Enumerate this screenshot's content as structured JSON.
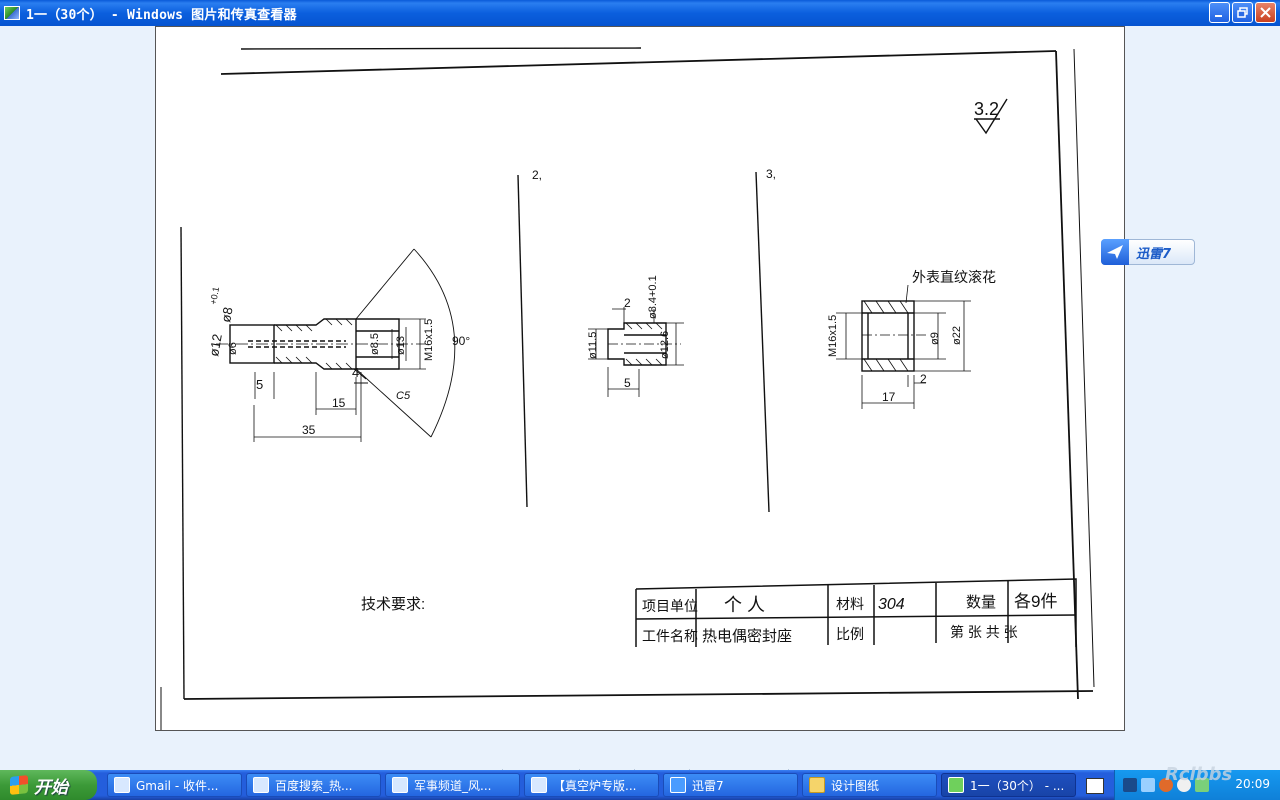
{
  "window": {
    "title": "1一（30个） - Windows 图片和传真查看器"
  },
  "drawing": {
    "surface_finish": "3.2",
    "view_numbers": [
      "2,",
      "3,"
    ],
    "part1_dims": {
      "d12": "ø12",
      "d6": "ø6",
      "d8": "ø8",
      "tol": "+0.1",
      "d8_5": "ø8.5",
      "d13": "ø13",
      "thread": "M16x1.5",
      "angle": "90°",
      "len5": "5",
      "len4": "4",
      "len15": "15",
      "len35": "35",
      "chamfer": "C5"
    },
    "part2_dims": {
      "d8_4": "ø8.4+0.1",
      "len2": "2",
      "d11_5": "ø11.5",
      "d12_6": "ø12.6",
      "len5": "5"
    },
    "part3_dims": {
      "note": "外表直纹滚花",
      "thread": "M16x1.5",
      "d9": "ø9",
      "d22": "ø22",
      "len2": "2",
      "len17": "17"
    },
    "tech_req": "技术要求:",
    "titleblock": {
      "project_unit_label": "项目单位",
      "project_unit_value": "个 人",
      "material_label": "材料",
      "material_value": "304",
      "qty_label": "数量",
      "qty_value": "各9件",
      "part_name_label": "工件名称",
      "part_name_value": "热电偶密封座",
      "scale_label": "比例",
      "sheet_text": "第  张  共  张"
    }
  },
  "overlay": {
    "xunlei_label": "迅雷7"
  },
  "toolbar": {
    "buttons": [
      "prev-image",
      "next-image",
      "best-fit",
      "actual-size",
      "slideshow",
      "zoom-in",
      "zoom-out",
      "rotate-clockwise",
      "rotate-counterclockwise",
      "delete",
      "print",
      "save-as",
      "edit",
      "help"
    ]
  },
  "taskbar": {
    "start_label": "开始",
    "tasks": [
      {
        "label": "Gmail - 收件...",
        "icon_color": "#d8e8ff"
      },
      {
        "label": "百度搜索_热...",
        "icon_color": "#d8e8ff"
      },
      {
        "label": "军事频道_风...",
        "icon_color": "#d8e8ff"
      },
      {
        "label": "【真空炉专版...",
        "icon_color": "#d8e8ff"
      },
      {
        "label": "迅雷7",
        "icon_color": "#4a9cff"
      },
      {
        "label": "设计图纸",
        "icon_color": "#f5d46a"
      },
      {
        "label": "1一（30个） - ...",
        "icon_color": "#6fd05c"
      }
    ],
    "clock": "20:09",
    "watermark": "Rclbbs"
  }
}
